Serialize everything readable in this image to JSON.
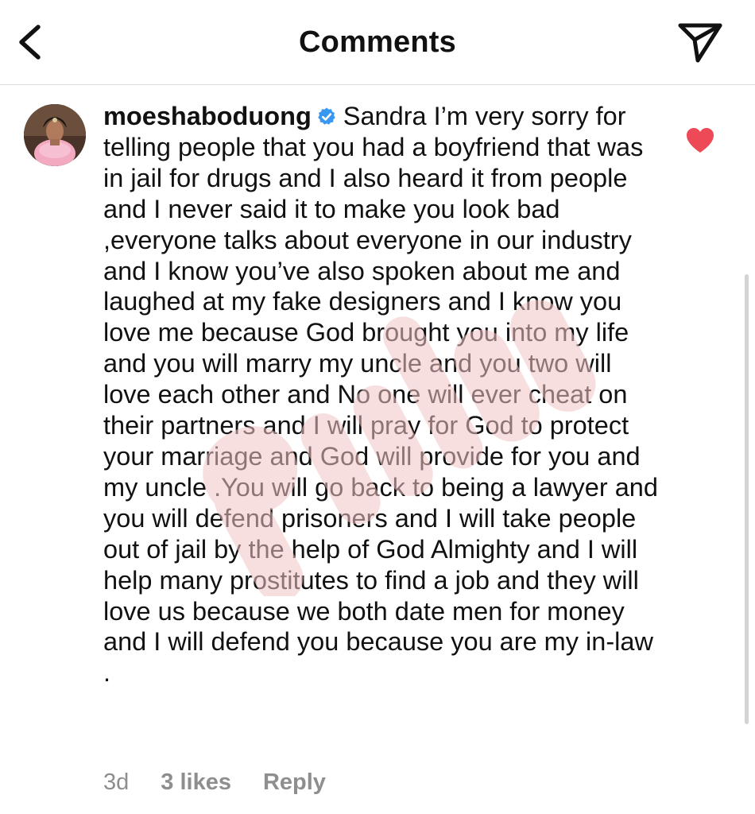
{
  "header": {
    "title": "Comments",
    "back_icon": "chevron-left-icon",
    "share_icon": "paper-plane-icon"
  },
  "comment": {
    "username": "moeshaboduong",
    "verified_icon": "verified-badge-icon",
    "text": "Sandra I’m very sorry for telling people that you had a boyfriend that was in jail for drugs and I also heard it from people and I never said it to make you look bad ,everyone talks about everyone in our industry and I know you’ve also spoken about me and laughed at my fake designers and I know you love me because God brought you into my life and you will marry my uncle and you two will love each other and No one will ever cheat on their partners and I will pray for God to protect your marriage and God will provide for you and my uncle .You will go back to being a lawyer and you will defend prisoners and I will take people out of jail by the help of God Almighty and I will help many prostitutes to find a job and they will love us because we both date men for money and I will defend you because you are my in-law .",
    "liked": true,
    "like_color": "#ed4956",
    "meta": {
      "time": "3d",
      "likes": "3 likes",
      "reply": "Reply"
    }
  },
  "colors": {
    "text": "#111111",
    "muted": "#8e8e8e",
    "verified": "#3897f0",
    "divider": "#dbdbdb"
  }
}
